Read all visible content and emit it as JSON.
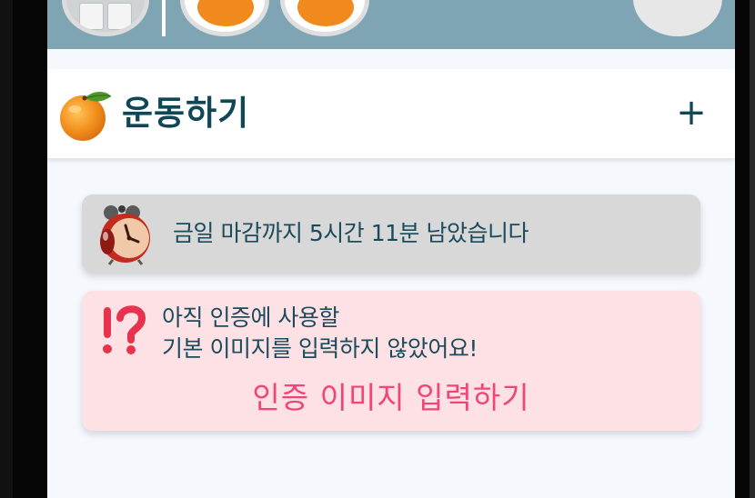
{
  "header": {
    "section_title": "운동하기",
    "add_label": "+"
  },
  "deadline": {
    "message": "금일 마감까지 5시간 11분 남았습니다"
  },
  "warning": {
    "line1": "아직 인증에 사용할",
    "line2": "기본 이미지를 입력하지 않았어요!",
    "action_label": "인증 이미지 입력하기"
  },
  "colors": {
    "topbar": "#7fa5b4",
    "title": "#0f4757",
    "deadline_card": "#d8d8d8",
    "warning_card": "#fde1e4",
    "accent_pink": "#f0447a"
  },
  "icons": [
    "orange-icon",
    "alarm-clock-icon",
    "exclamation-question-icon"
  ]
}
